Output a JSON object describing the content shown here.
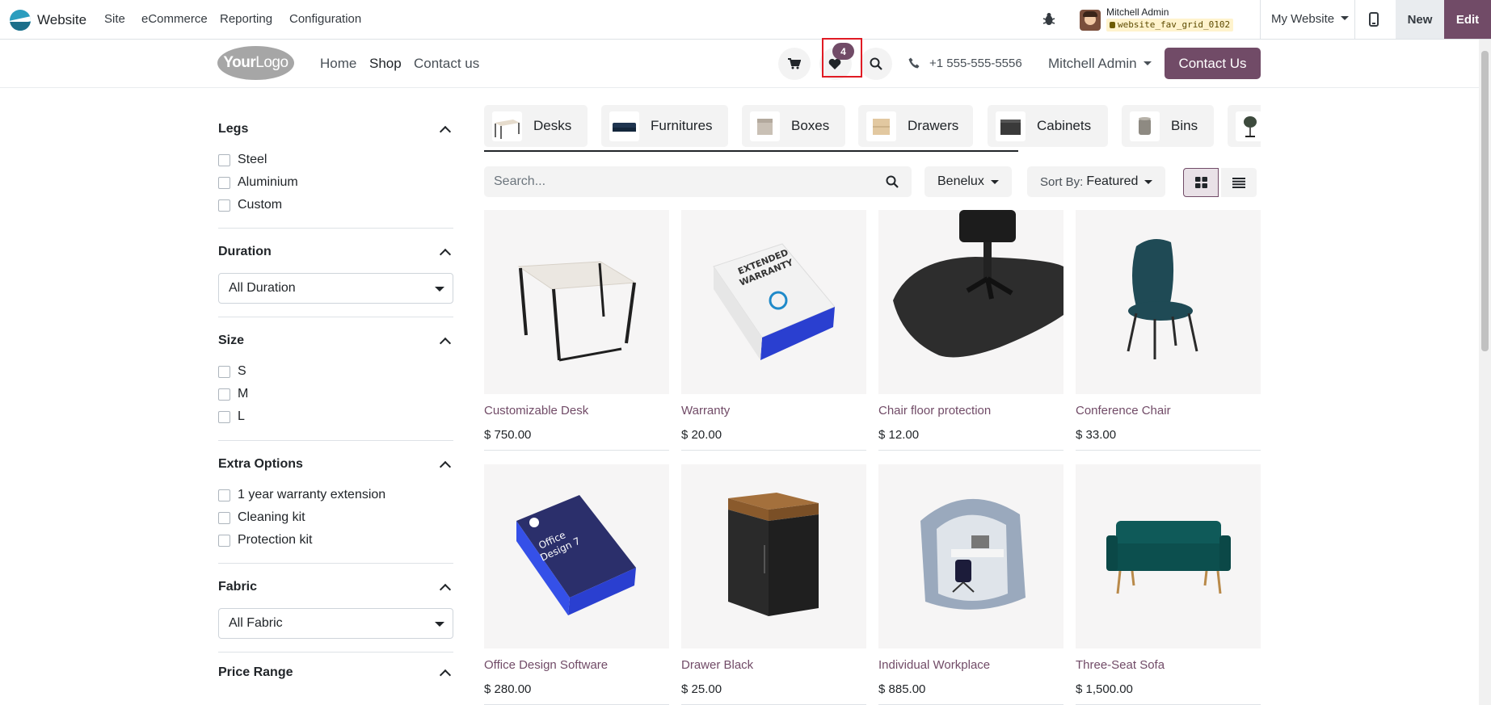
{
  "topbar": {
    "app_name": "Website",
    "menu": [
      "Site",
      "eCommerce",
      "Reporting",
      "Configuration"
    ],
    "user_name": "Mitchell Admin",
    "database": "website_fav_grid_0102",
    "my_website_label": "My Website",
    "new_label": "New",
    "edit_label": "Edit",
    "accent_color": "#714b67"
  },
  "header": {
    "logo_text_a": "Your",
    "logo_text_b": "Logo",
    "nav": [
      "Home",
      "Shop",
      "Contact us"
    ],
    "active_nav": "Shop",
    "wishlist_count": "4",
    "phone": "+1 555-555-5556",
    "user_menu": "Mitchell Admin",
    "contact_button": "Contact Us"
  },
  "filters": {
    "legs": {
      "title": "Legs",
      "options": [
        "Steel",
        "Aluminium",
        "Custom"
      ]
    },
    "duration": {
      "title": "Duration",
      "selected": "All Duration"
    },
    "size": {
      "title": "Size",
      "options": [
        "S",
        "M",
        "L"
      ]
    },
    "extra_options": {
      "title": "Extra Options",
      "options": [
        "1 year warranty extension",
        "Cleaning kit",
        "Protection kit"
      ]
    },
    "fabric": {
      "title": "Fabric",
      "selected": "All Fabric"
    },
    "price_range": {
      "title": "Price Range"
    }
  },
  "categories": [
    "Desks",
    "Furnitures",
    "Boxes",
    "Drawers",
    "Cabinets",
    "Bins"
  ],
  "toolbar": {
    "search_placeholder": "Search...",
    "pricelist": "Benelux",
    "sort_prefix": "Sort By:",
    "sort_value": "Featured"
  },
  "products": [
    {
      "name": "Customizable Desk",
      "price": "$ 750.00"
    },
    {
      "name": "Warranty",
      "price": "$ 20.00"
    },
    {
      "name": "Chair floor protection",
      "price": "$ 12.00"
    },
    {
      "name": "Conference Chair",
      "price": "$ 33.00"
    },
    {
      "name": "Office Design Software",
      "price": "$ 280.00"
    },
    {
      "name": "Drawer Black",
      "price": "$ 25.00"
    },
    {
      "name": "Individual Workplace",
      "price": "$ 885.00"
    },
    {
      "name": "Three-Seat Sofa",
      "price": "$ 1,500.00"
    }
  ],
  "product_art": {
    "warranty_box_text_1": "EXTENDED",
    "warranty_box_text_2": "WARRANTY",
    "software_box_text_1": "Office",
    "software_box_text_2": "Design 7"
  }
}
